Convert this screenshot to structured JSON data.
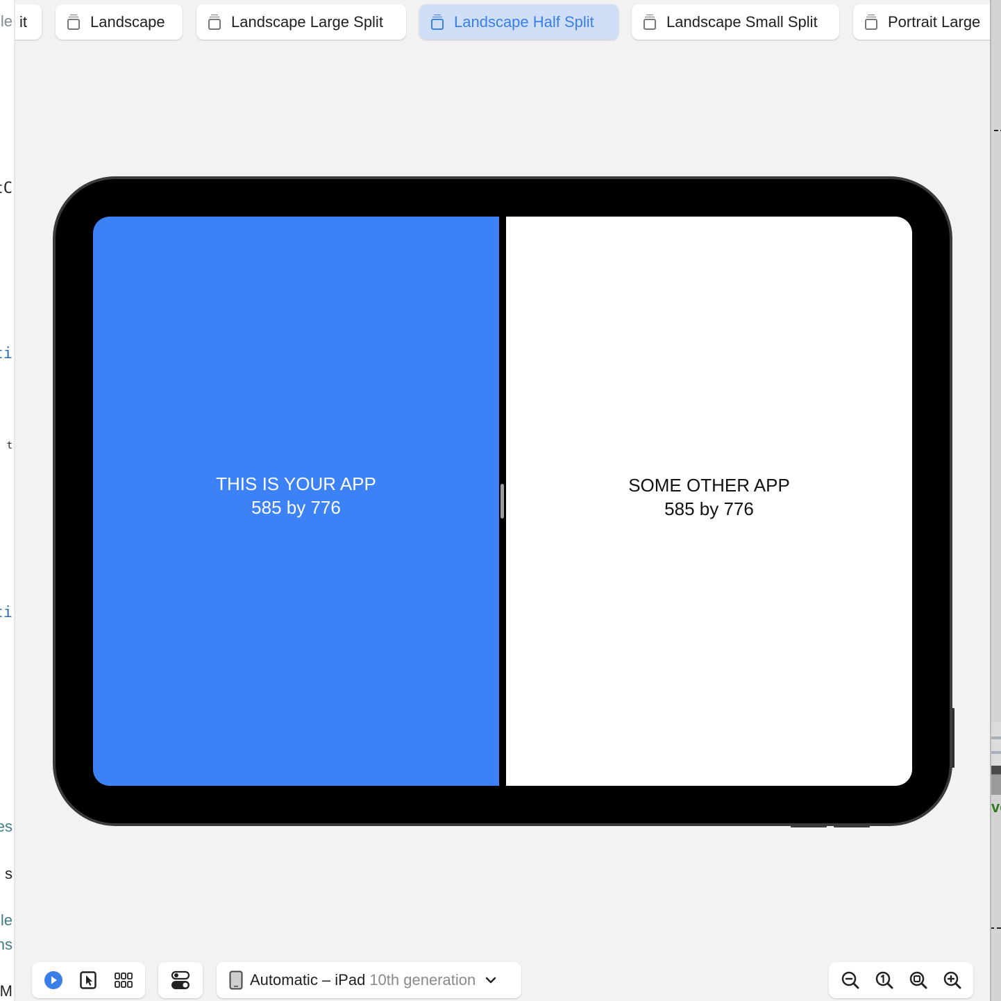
{
  "editor_fragments": [
    {
      "text": "le",
      "style": "gray"
    },
    {
      "text": "tC",
      "style": "black"
    },
    {
      "text": "ti",
      "style": "blue"
    },
    {
      "text": "t",
      "style": "black"
    },
    {
      "text": "ti",
      "style": "blue"
    },
    {
      "text": "es",
      "style": "teal"
    },
    {
      "text": "s",
      "style": "black"
    },
    {
      "text": "le",
      "style": "teal"
    },
    {
      "text": "ns",
      "style": "teal"
    },
    {
      "text": "eM",
      "style": "black"
    }
  ],
  "right_panel": {
    "fragment": "ve"
  },
  "layout_chips": {
    "items": [
      {
        "label": "it",
        "selected": false,
        "partial": true
      },
      {
        "label": "Landscape",
        "selected": false
      },
      {
        "label": "Landscape Large Split",
        "selected": false
      },
      {
        "label": "Landscape Half Split",
        "selected": true
      },
      {
        "label": "Landscape Small Split",
        "selected": false
      },
      {
        "label": "Portrait Large",
        "selected": false,
        "partial": true
      }
    ],
    "accent_color": "#3a7ee8"
  },
  "preview": {
    "your_app": {
      "title": "THIS IS YOUR APP",
      "size": "585 by 776",
      "color": "#3c82f6"
    },
    "other_app": {
      "title": "SOME OTHER APP",
      "size": "585 by 776",
      "color": "#ffffff"
    }
  },
  "bottom_toolbar": {
    "mode_buttons": [
      {
        "icon": "play-circle-icon",
        "label": "Live",
        "active": true
      },
      {
        "icon": "cursor-select-icon",
        "label": "Selectable"
      },
      {
        "icon": "variants-grid-icon",
        "label": "Variants"
      }
    ],
    "settings_icon": "device-settings-toggle-icon",
    "device": {
      "name": "Automatic – iPad",
      "detail": "10th generation",
      "icon": "ipad-icon"
    },
    "zoom_buttons": [
      {
        "icon": "zoom-out-icon",
        "label": "Zoom Out"
      },
      {
        "icon": "zoom-100-icon",
        "label": "Zoom to 100%"
      },
      {
        "icon": "zoom-to-fit-icon",
        "label": "Zoom to Fit"
      },
      {
        "icon": "zoom-in-icon",
        "label": "Zoom In"
      }
    ]
  }
}
